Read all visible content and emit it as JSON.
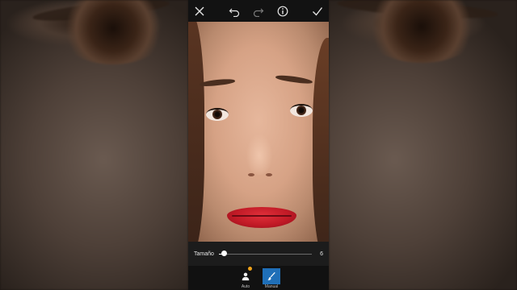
{
  "toolbar": {
    "close_icon": "close-icon",
    "undo_icon": "undo-icon",
    "redo_icon": "redo-icon",
    "info_icon": "info-icon",
    "confirm_icon": "checkmark-icon"
  },
  "photo": {
    "subject": "woman-face-portrait"
  },
  "slider": {
    "label": "Tamaño",
    "value": "6",
    "min": 0,
    "max": 100,
    "level_fraction": 0.06
  },
  "tools": [
    {
      "label": "Auto",
      "icon": "person-icon",
      "badge": "premium-star",
      "active": false
    },
    {
      "label": "Manual",
      "icon": "brush-icon",
      "active": true
    }
  ],
  "colors": {
    "active_tool": "#1f6fb8",
    "badge": "#f0a21a",
    "bar_bg": "#1c1c1c",
    "topbar_bg": "#121212"
  }
}
